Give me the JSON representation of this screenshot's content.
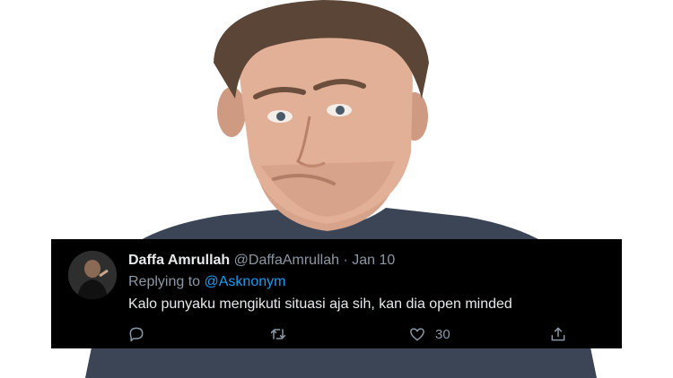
{
  "tweet": {
    "display_name": "Daffa Amrullah",
    "handle": "@DaffaAmrullah",
    "separator": "·",
    "date": "Jan 10",
    "replying_prefix": "Replying to",
    "replying_to": "@Asknonym",
    "text": "Kalo punyaku mengikuti situasi aja sih, kan dia open minded",
    "likes": "30"
  },
  "colors": {
    "card_bg": "#000000",
    "mention": "#1d9bf0",
    "muted": "#8b98a5",
    "shirt": "#3b4556"
  },
  "icons": [
    "reply-icon",
    "retweet-icon",
    "like-icon",
    "share-icon"
  ]
}
